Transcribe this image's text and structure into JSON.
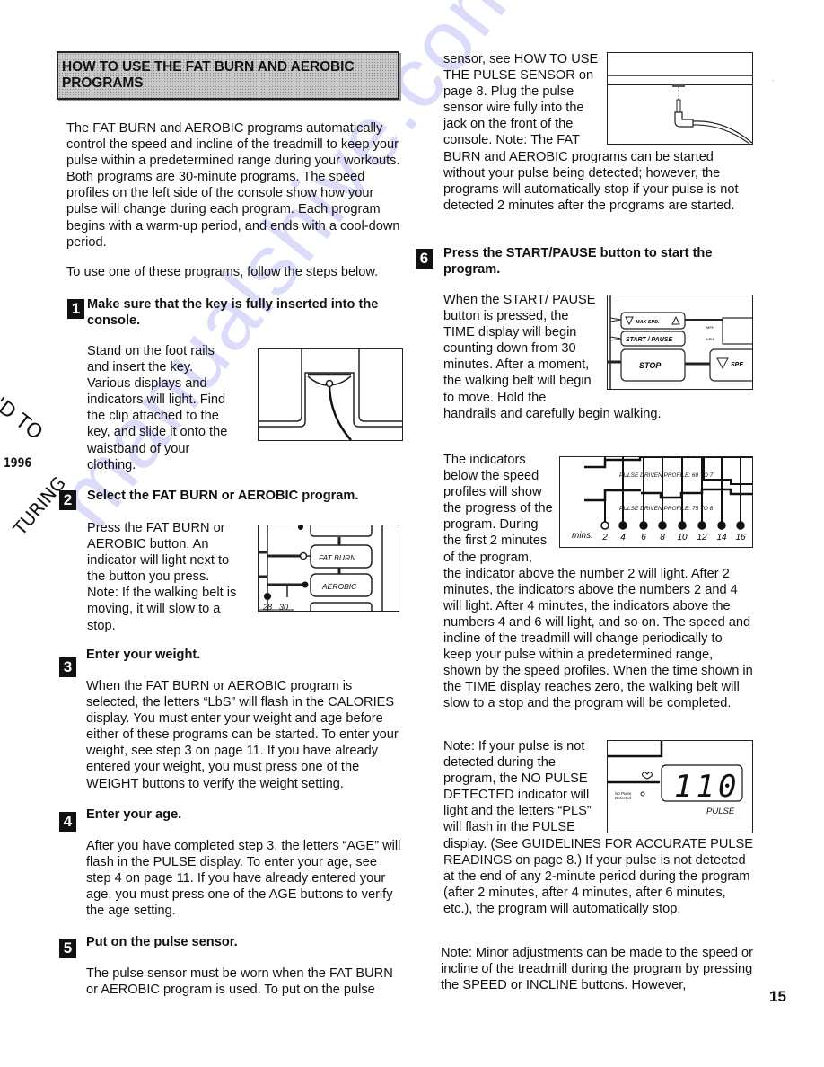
{
  "page": {
    "page_number": "15",
    "watermark": "manualshive.com"
  },
  "section": {
    "title_line1": "HOW TO USE THE FAT BURN AND AEROBIC",
    "title_line2": "PROGRAMS",
    "intro": "The FAT BURN and AEROBIC programs automatically control the speed and incline of the treadmill to keep your pulse within a predetermined range during your workouts. Both programs are 30-minute programs. The speed profiles on the left side of the console show how your pulse will change during each program. Each program begins with a warm-up period, and ends with a cool-down period.",
    "lead_in": "To use one of these programs, follow the steps below."
  },
  "margin_marks": {
    "stamp_top": "'D TO",
    "year": "1996",
    "stamp_bottom": "TURING"
  },
  "steps": [
    {
      "number": "1",
      "heading": "Make sure that the key is fully inserted into the console.",
      "body": "Stand on the foot rails and insert the key. Various displays and indicators will light. Find the clip attached to the key, and slide it onto the waistband of your clothing."
    },
    {
      "number": "2",
      "heading": "Select the FAT BURN or AEROBIC program.",
      "body": "Press the FAT BURN or AEROBIC button. An indicator will light next to the button you press. Note: If the walking belt is moving, it will slow to a stop."
    },
    {
      "number": "3",
      "heading": "Enter your weight.",
      "body": "When the FAT BURN or AEROBIC program is selected, the letters “LbS” will flash in the CALORIES display. You must enter your weight and age before either of these programs can be started. To enter your weight, see step 3 on page 11. If you have already entered your weight, you must press one of the WEIGHT buttons to verify the weight setting."
    },
    {
      "number": "4",
      "heading": "Enter your age.",
      "body": "After you have completed step 3, the letters “AGE” will flash in the PULSE display. To enter your age, see step 4 on page 11. If you have already entered your age, you must press one of the AGE buttons to verify the age setting."
    },
    {
      "number": "5",
      "heading": "Put on the pulse sensor.",
      "body": "The pulse sensor must be worn when the FAT BURN or AEROBIC program is used. To put on the pulse",
      "body_continued": "sensor, see HOW TO USE THE PULSE SENSOR on page 8. Plug the pulse sensor wire fully into the jack on the front of the console. Note: The FAT BURN and AEROBIC programs can be started without your pulse being detected; however, the programs will automatically stop if your pulse is not detected 2 minutes after the programs are started."
    },
    {
      "number": "6",
      "heading": "Press the START/PAUSE button to start the program.",
      "body": "When the START/ PAUSE button is pressed, the TIME display will begin counting down from 30 minutes. After a moment, the walking belt will begin to move. Hold the handrails and carefully begin walking.",
      "indicators_text": "The indicators below the speed profiles will show the progress of the program. During the first 2 minutes of the program, the indicator above the number 2 will light. After 2 minutes, the indicators above the numbers 2 and 4 will light. After 4 minutes, the indicators above the numbers 4 and 6 will light, and so on. The speed and incline of the treadmill will change periodically to keep your pulse within a predetermined range, shown by the speed profiles. When the time shown in the TIME display reaches zero, the walking belt will slow to a stop and the program will be completed.",
      "note_pulse": "Note: If your pulse is not detected during the program, the NO PULSE DETECTED indicator will light and the letters “PLS” will flash in the PULSE display. (See GUIDELINES FOR ACCURATE PULSE READINGS on page 8.) If your pulse is not detected at the end of any 2-minute period during the program (after 2 minutes, after 4 minutes, after 6 minutes, etc.), the program will automatically stop.",
      "note_adjust": "Note: Minor adjustments can be made to the speed or incline of the treadmill during the program by pressing the SPEED or INCLINE buttons. However,"
    }
  ],
  "figures": {
    "program_buttons": {
      "fat_burn": "FAT BURN",
      "aerobic": "AEROBIC",
      "scale_28": "28",
      "scale_30": "30"
    },
    "console_buttons": {
      "max_speed": "MAX SPD.",
      "start_pause": "START / PAUSE",
      "stop": "STOP",
      "speed": "SPE",
      "mph": "MPH",
      "kph": "KPH"
    },
    "profile_indicators": {
      "profile_1": "PULSE DRIVEN PROFILE: 60 TO 7",
      "profile_2": "PULSE DRIVEN PROFILE: 75 TO 8",
      "mins_label": "mins.",
      "minutes": [
        "2",
        "4",
        "6",
        "8",
        "10",
        "12",
        "14",
        "16"
      ],
      "lit": [
        false,
        true,
        true,
        true,
        true,
        true,
        true,
        true
      ]
    },
    "pulse_display": {
      "value": "110",
      "label": "PULSE",
      "no_pulse_line1": "No Pulse",
      "no_pulse_line2": "Detected"
    }
  }
}
